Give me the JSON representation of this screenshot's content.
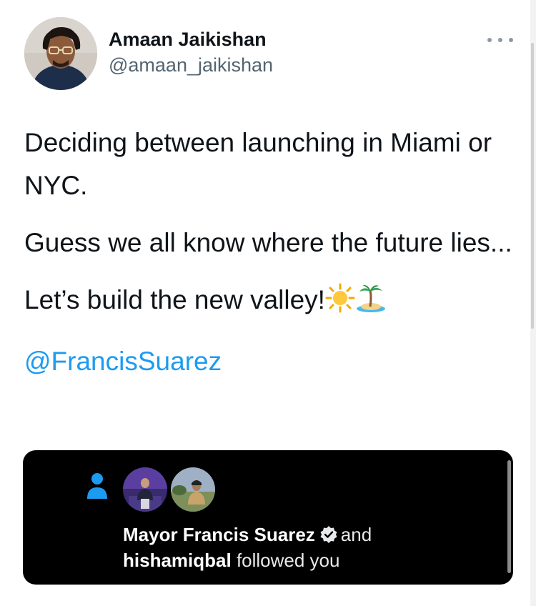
{
  "tweet": {
    "author": {
      "display_name": "Amaan Jaikishan",
      "handle": "@amaan_jaikishan",
      "avatar": "profile-photo"
    },
    "more_icon": "more-horizontal-icon",
    "paragraphs": [
      "Deciding between launching in Miami or NYC.",
      "Guess we all know where the future lies...",
      "Let’s build the new valley!"
    ],
    "emojis": [
      "sun-emoji",
      "desert-island-emoji"
    ],
    "mention": "@FrancisSuarez"
  },
  "embedded_card": {
    "icon": "person-icon",
    "avatars": [
      "mayor-francis-suarez-avatar",
      "hishamiqbal-avatar"
    ],
    "name1": "Mayor Francis Suarez",
    "verified_icon": "verified-badge-icon",
    "conjunction": "and",
    "name2": "hishamiqbal",
    "action": "followed you",
    "accent": "#1d9bf0",
    "background": "#000000"
  }
}
